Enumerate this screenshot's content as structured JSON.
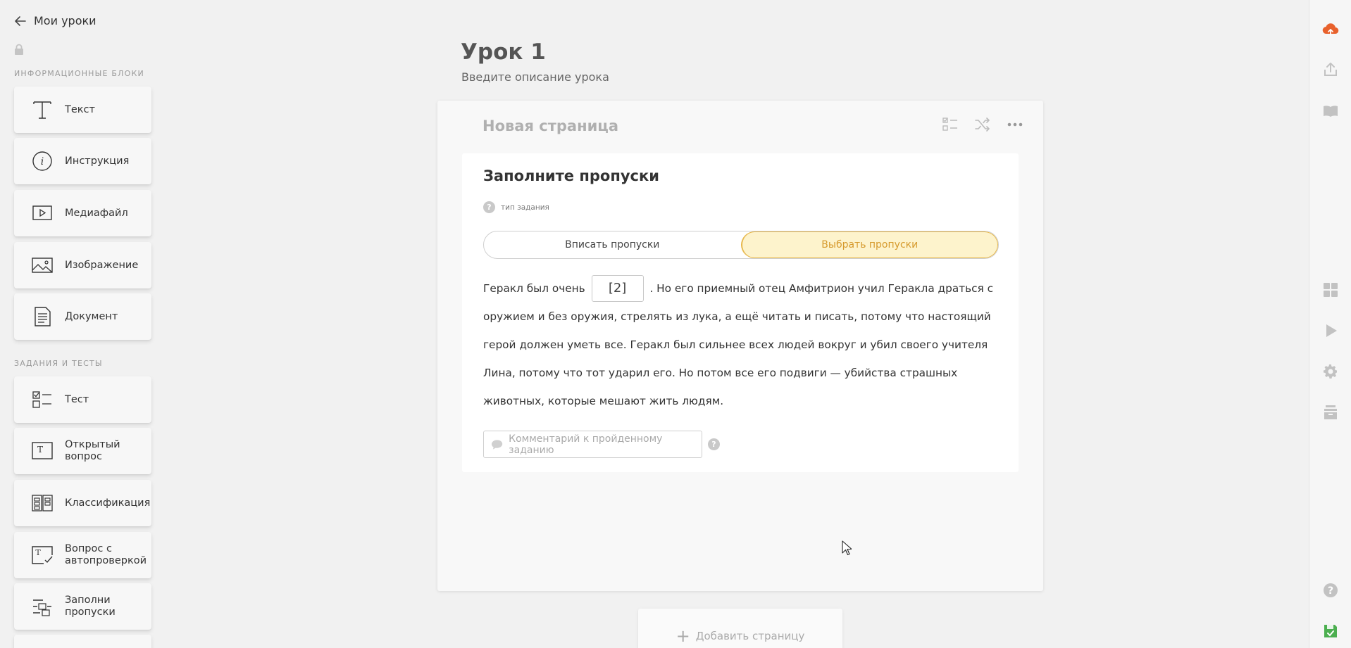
{
  "sidebar": {
    "back_label": "Мои уроки",
    "section_info": "ИНФОРМАЦИОННЫЕ БЛОКИ",
    "section_tasks": "ЗАДАНИЯ И ТЕСТЫ",
    "info_blocks": [
      {
        "label": "Текст",
        "icon": "text-icon"
      },
      {
        "label": "Инструкция",
        "icon": "info-icon"
      },
      {
        "label": "Медиафайл",
        "icon": "media-play-icon"
      },
      {
        "label": "Изображение",
        "icon": "image-icon"
      },
      {
        "label": "Документ",
        "icon": "document-icon"
      }
    ],
    "task_blocks": [
      {
        "label": "Тест",
        "icon": "checklist-icon"
      },
      {
        "label": "Открытый\nвопрос",
        "icon": "open-question-icon"
      },
      {
        "label": "Классификация",
        "icon": "classification-icon"
      },
      {
        "label": "Вопрос с\nавтопроверкой",
        "icon": "autocheck-icon"
      },
      {
        "label": "Заполни\nпропуски",
        "icon": "fill-gaps-icon"
      }
    ]
  },
  "lesson": {
    "title": "Урок 1",
    "description_placeholder": "Введите описание урока"
  },
  "page": {
    "title": "Новая страница",
    "tools": [
      "checklist-icon",
      "shuffle-icon",
      "more-icon"
    ]
  },
  "task": {
    "title": "Заполните пропуски",
    "type_label": "тип задания",
    "modes": [
      "Вписать пропуски",
      "Выбрать пропуски"
    ],
    "active_mode": "Выбрать пропуски",
    "text_before_gap": "Геракл был очень",
    "gap_label": "[2]",
    "text_after_gap": ". Но его приемный отец Амфитрион учил Геракла драться с оружием и без оружия, стрелять из лука, а ещё  читать и писать, потому что настоящий герой должен уметь все. Геракл был сильнее всех людей вокруг и убил своего учителя Лина, потому что тот ударил его. Но потом все его подвиги — убийства страшных животных, которые мешают жить людям.",
    "comment_placeholder": "Комментарий к пройденному заданию"
  },
  "add_page_label": "Добавить страницу",
  "right_rail": {
    "top_icons": [
      "cloud-upload-icon",
      "share-icon",
      "book-icon"
    ],
    "middle_icons": [
      "grid-icon",
      "play-icon",
      "settings-icon",
      "archive-icon"
    ],
    "bottom_icons": [
      "help-icon",
      "save-icon"
    ]
  },
  "colors": {
    "accent_orange": "#e8612c",
    "active_mode_bg": "#fdf3cc",
    "active_mode_text": "#d69a2d",
    "save_green": "#4caf50"
  }
}
